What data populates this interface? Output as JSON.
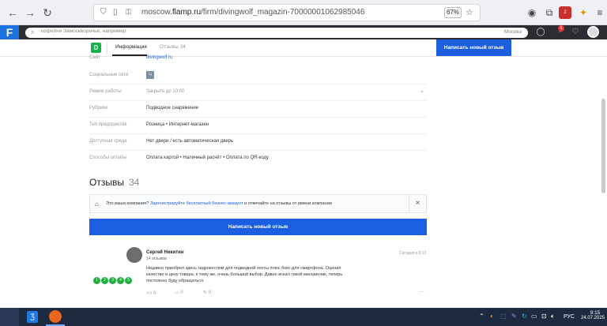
{
  "browser": {
    "url_prefix": "moscow.",
    "url_domain": "flamp.ru",
    "url_path": "/firm/divingwolf_magazin-70000001062985046",
    "zoom": "67%",
    "badge_count": "2"
  },
  "site": {
    "search_placeholder": "кофейня Замоскворечье, например",
    "city": "Москва",
    "notif_count": "6"
  },
  "tabs": {
    "info_label": "Информация",
    "reviews_label": "Отзывы",
    "reviews_count": "34",
    "write_review": "Написать новый отзыв"
  },
  "info": [
    {
      "label": "Сайт",
      "value": "divingwolf.ru"
    },
    {
      "label": "Социальные сети",
      "value": "Ч"
    },
    {
      "label": "Режим работы",
      "value": "Закрыто до 10:00"
    },
    {
      "label": "Рубрики",
      "value": "Подводное снаряжение"
    },
    {
      "label": "Тип предприятия",
      "value": "Розница • Интернет-магазин"
    },
    {
      "label": "Доступная среда",
      "value": "Нет двери / есть автоматическая дверь"
    },
    {
      "label": "Способы оплаты",
      "value": "Оплата картой • Наличный расчёт • Оплата по QR-коду"
    }
  ],
  "reviews": {
    "title": "Отзывы",
    "count": "34",
    "claim_prefix": "Это ваша компания?",
    "claim_link": "Зарегистрируйте бесплатный бизнес-аккаунт",
    "claim_suffix": "и отвечайте на отзывы от имени компании",
    "write_review": "Написать новый отзыв",
    "item": {
      "author": "Сергей Никитин",
      "author_meta": "14 отзывов",
      "date": "Сегодня в 9:12",
      "text_line1": "Недавно приобрел здесь гидрокостюм для подводной охоты плюс бокс для смартфона. Оценил",
      "text_line2": "качество и цену товара, к тому же, очень большой выбор. Давно искал такой магазинчик, теперь",
      "text_line3": "постоянно буду обращаться.",
      "rating": 5,
      "likes": "0",
      "comments": "0",
      "shares": "0"
    }
  },
  "taskbar": {
    "lang": "РУС",
    "time": "9:15",
    "date": "24.07.2025"
  }
}
